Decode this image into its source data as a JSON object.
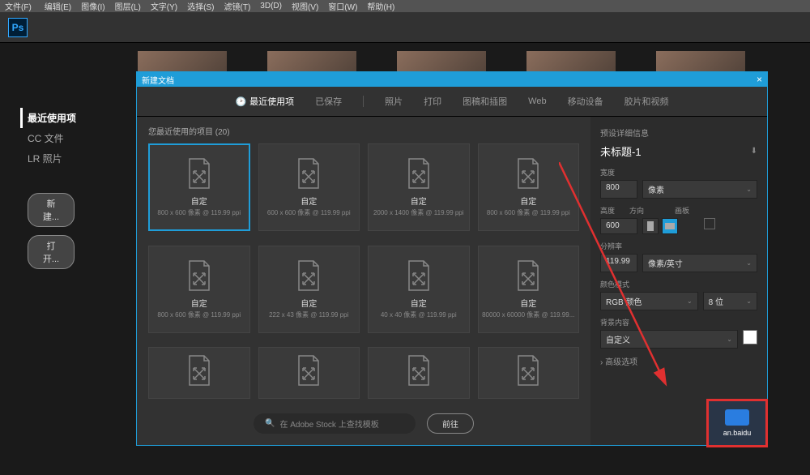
{
  "menubar": [
    "文件(F)",
    "编辑(E)",
    "图像(I)",
    "图层(L)",
    "文字(Y)",
    "选择(S)",
    "滤镜(T)",
    "3D(D)",
    "视图(V)",
    "窗口(W)",
    "帮助(H)"
  ],
  "logo": "Ps",
  "sidebar": {
    "items": [
      "最近使用项",
      "CC 文件",
      "LR 照片"
    ],
    "new_btn": "新建...",
    "open_btn": "打开..."
  },
  "bg_thumbs": [
    "人像.jpg",
    "墙面.png",
    "街景.png",
    "故宫.png",
    "红米2.jpg"
  ],
  "dialog": {
    "title": "新建文档",
    "tabs": [
      "最近使用项",
      "已保存",
      "照片",
      "打印",
      "图稿和插图",
      "Web",
      "移动设备",
      "胶片和视频"
    ],
    "presets_header": "您最近使用的项目 (20)",
    "presets": [
      {
        "name": "自定",
        "detail": "800 x 600 像素 @ 119.99 ppi"
      },
      {
        "name": "自定",
        "detail": "600 x 600 像素 @ 119.99 ppi"
      },
      {
        "name": "自定",
        "detail": "2000 x 1400 像素 @ 119.99 ppi"
      },
      {
        "name": "自定",
        "detail": "800 x 600 像素 @ 119.99 ppi"
      },
      {
        "name": "自定",
        "detail": "800 x 600 像素 @ 119.99 ppi"
      },
      {
        "name": "自定",
        "detail": "222 x 43 像素 @ 119.99 ppi"
      },
      {
        "name": "自定",
        "detail": "40 x 40 像素 @ 119.99 ppi"
      },
      {
        "name": "自定",
        "detail": "80000 x 60000 像素 @ 119.99..."
      }
    ],
    "search_placeholder": "在 Adobe Stock 上查找模板",
    "go_btn": "前往",
    "details": {
      "header": "预设详细信息",
      "doc_title": "未标题-1",
      "width_label": "宽度",
      "width_value": "800",
      "width_unit": "像素",
      "height_label": "高度",
      "orient_label": "方向",
      "artboard_label": "画板",
      "height_value": "600",
      "res_label": "分辨率",
      "res_value": "119.99",
      "res_unit": "像素/英寸",
      "color_mode_label": "颜色模式",
      "color_mode": "RGB 颜色",
      "bit_depth": "8 位",
      "bg_label": "背景内容",
      "bg_value": "自定义",
      "advanced": "高级选项"
    }
  },
  "watermark": "an.baidu"
}
